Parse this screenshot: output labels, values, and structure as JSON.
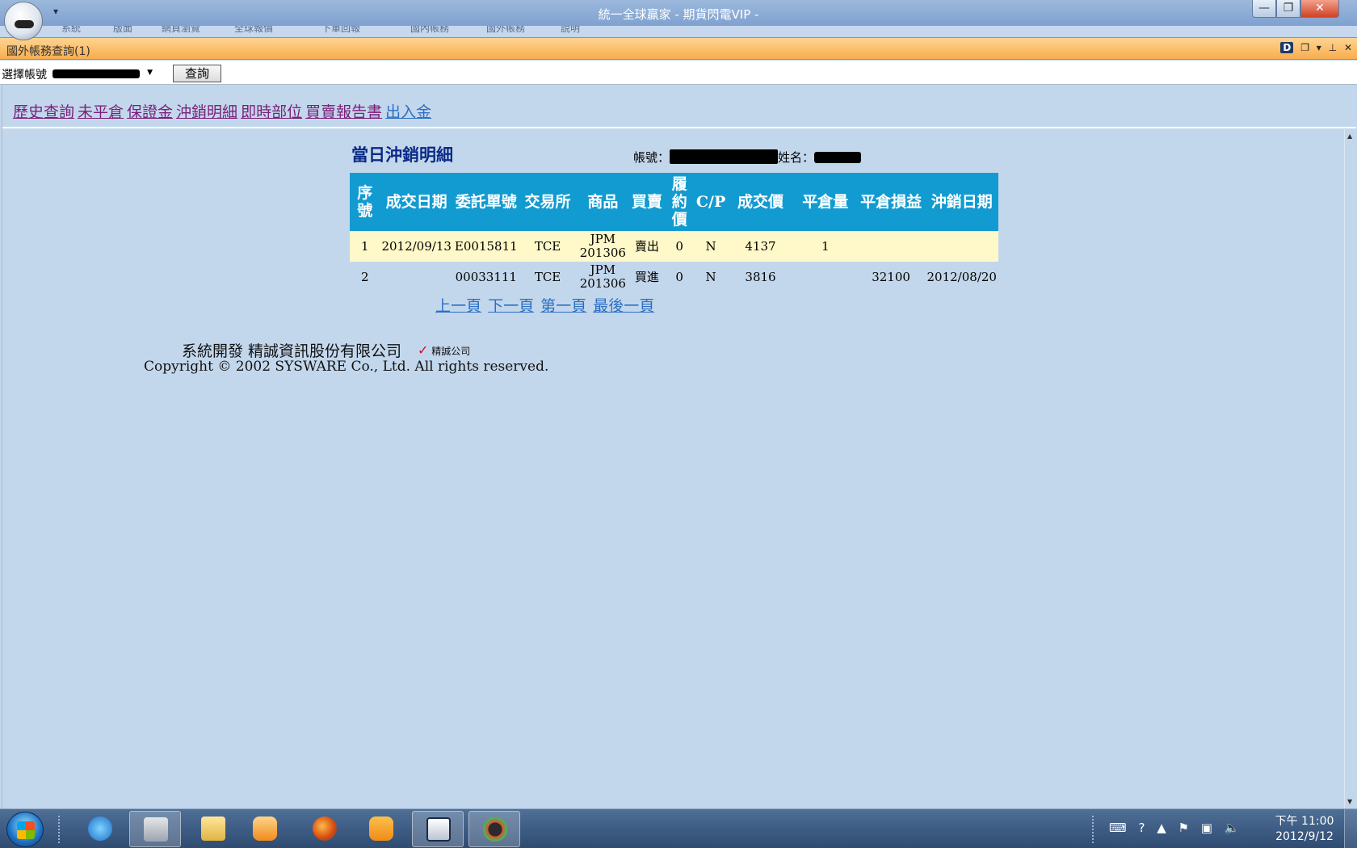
{
  "window": {
    "title": "統一全球贏家 - 期貨閃電VIP -"
  },
  "ribbon": {
    "tabs": [
      "系統",
      "版面",
      "網頁瀏覽",
      "全球報價",
      "下單回報",
      "國內帳務",
      "國外帳務",
      "說明"
    ]
  },
  "panel": {
    "title": "國外帳務查詢(1)"
  },
  "account_select": {
    "label": "選擇帳號",
    "query_button": "查詢"
  },
  "nav": {
    "links": [
      "歷史查詢",
      "未平倉",
      "保證金",
      "沖銷明細",
      "即時部位",
      "買賣報告書",
      "出入金"
    ]
  },
  "section": {
    "title": "當日沖銷明細",
    "account_label": "帳號：",
    "name_label": "姓名："
  },
  "table": {
    "headers": [
      "序號",
      "成交日期",
      "委託單號",
      "交易所",
      "商品",
      "買賣",
      "履約價",
      "C/P",
      "成交價",
      "平倉量",
      "平倉損益",
      "沖銷日期"
    ],
    "rows": [
      [
        "1",
        "2012/09/13",
        "E0015811",
        "TCE",
        "JPM 201306",
        "賣出",
        "0",
        "N",
        "4137",
        "1",
        "",
        ""
      ],
      [
        "2",
        "",
        "00033111",
        "TCE",
        "JPM 201306",
        "買進",
        "0",
        "N",
        "3816",
        "",
        "32100",
        "2012/08/20"
      ]
    ]
  },
  "pager": {
    "prev": "上一頁",
    "next": "下一頁",
    "first": "第一頁",
    "last": "最後一頁"
  },
  "footer": {
    "developer": "系統開發 精誠資訊股份有限公司",
    "logo_text": "精誠公司",
    "copyright": "Copyright © 2002 SYSWARE Co., Ltd. All rights reserved."
  },
  "taskbar": {
    "clock_time": "下午 11:00",
    "clock_date": "2012/9/12"
  },
  "colors": {
    "table_header": "#129bd0",
    "row_highlight": "#fff8c8",
    "sell": "#18b818",
    "buy": "#e0201c",
    "panel_bar": "#f8ad4e"
  }
}
